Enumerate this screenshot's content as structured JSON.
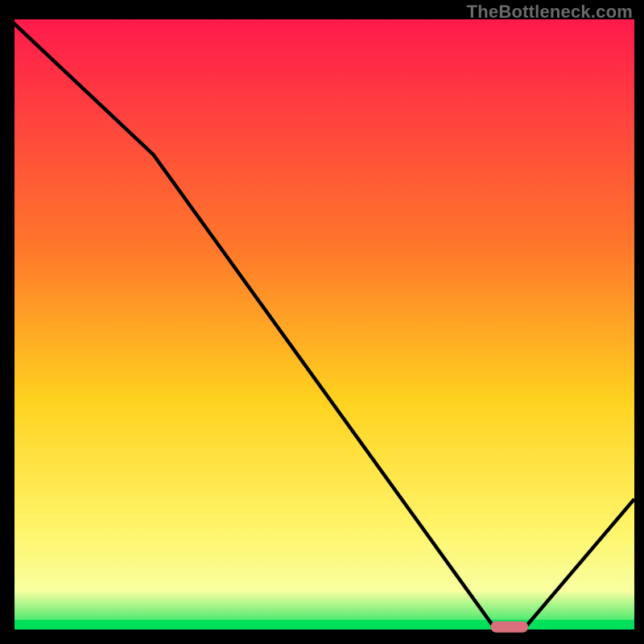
{
  "watermark": "TheBottleneck.com",
  "colors": {
    "gradient_top": "#ff1a4c",
    "gradient_mid1": "#ff7a2a",
    "gradient_mid2": "#ffd21f",
    "gradient_mid3": "#fff56a",
    "gradient_low": "#f7ffa0",
    "gradient_bottom": "#00e05a",
    "axis": "#000000",
    "curve": "#000000",
    "marker": "#d86f7a"
  },
  "chart_data": {
    "type": "line",
    "title": "",
    "xlabel": "",
    "ylabel": "",
    "xlim": [
      0,
      100
    ],
    "ylim": [
      0,
      100
    ],
    "x": [
      0,
      23,
      78,
      82,
      100
    ],
    "values": [
      100,
      78,
      0.5,
      0.5,
      22
    ],
    "marker": {
      "x_start": 77,
      "x_end": 83,
      "y": 1.2
    },
    "annotations": []
  }
}
